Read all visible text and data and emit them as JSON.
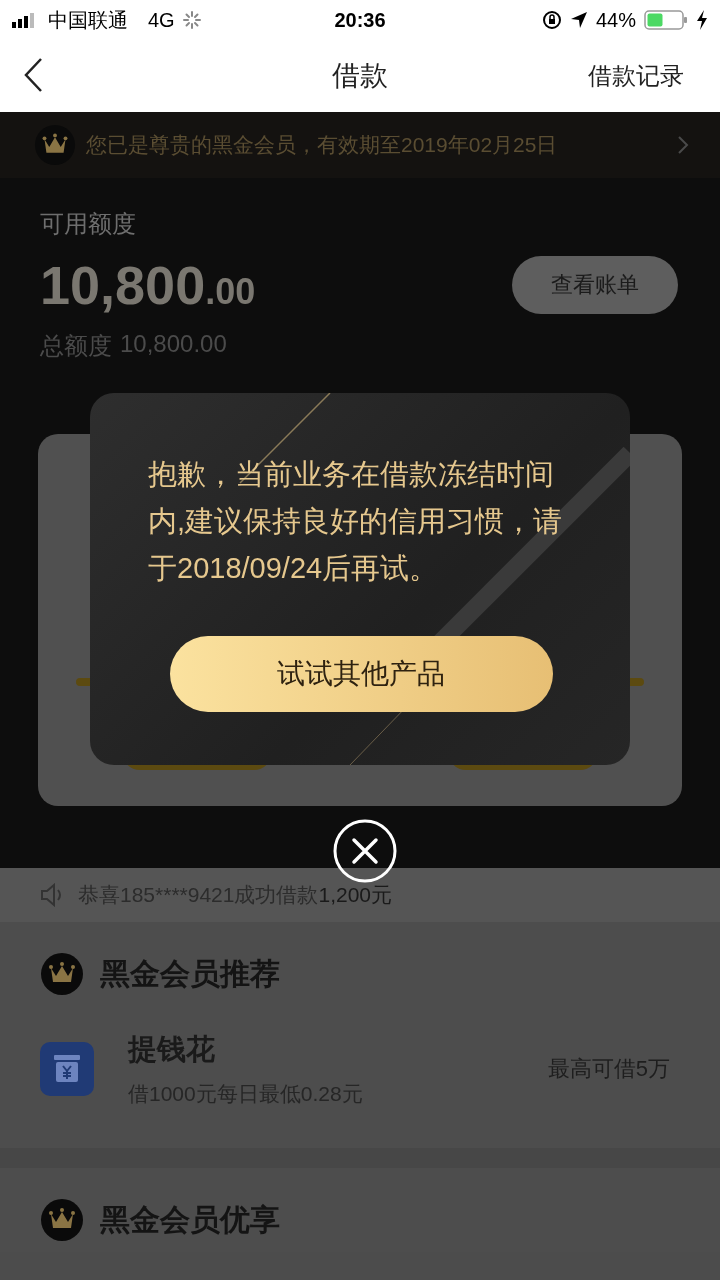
{
  "status_bar": {
    "carrier": "中国联通",
    "network": "4G",
    "time": "20:36",
    "battery_text": "44%"
  },
  "nav": {
    "title": "借款",
    "action": "借款记录"
  },
  "member_banner": {
    "text": "您已是尊贵的黑金会员，有效期至2019年02月25日"
  },
  "credit": {
    "available_label": "可用额度",
    "amount_main": "10,800",
    "amount_decimal": ".00",
    "bill_button": "查看账单",
    "total_label": "总额度",
    "total_value": "10,800.00"
  },
  "dialog": {
    "message": "抱歉，当前业务在借款冻结时间内,建议保持良好的信用习惯，请于2018/09/24后再试。",
    "button": "试试其他产品"
  },
  "notice": {
    "text": "恭喜185****9421成功借款",
    "amount": "1,200元"
  },
  "sections": [
    {
      "title": "黑金会员推荐",
      "items": [
        {
          "name": "提钱花",
          "desc": "借1000元每日最低0.28元",
          "limit": "最高可借5万"
        }
      ]
    },
    {
      "title": "黑金会员优享"
    }
  ]
}
